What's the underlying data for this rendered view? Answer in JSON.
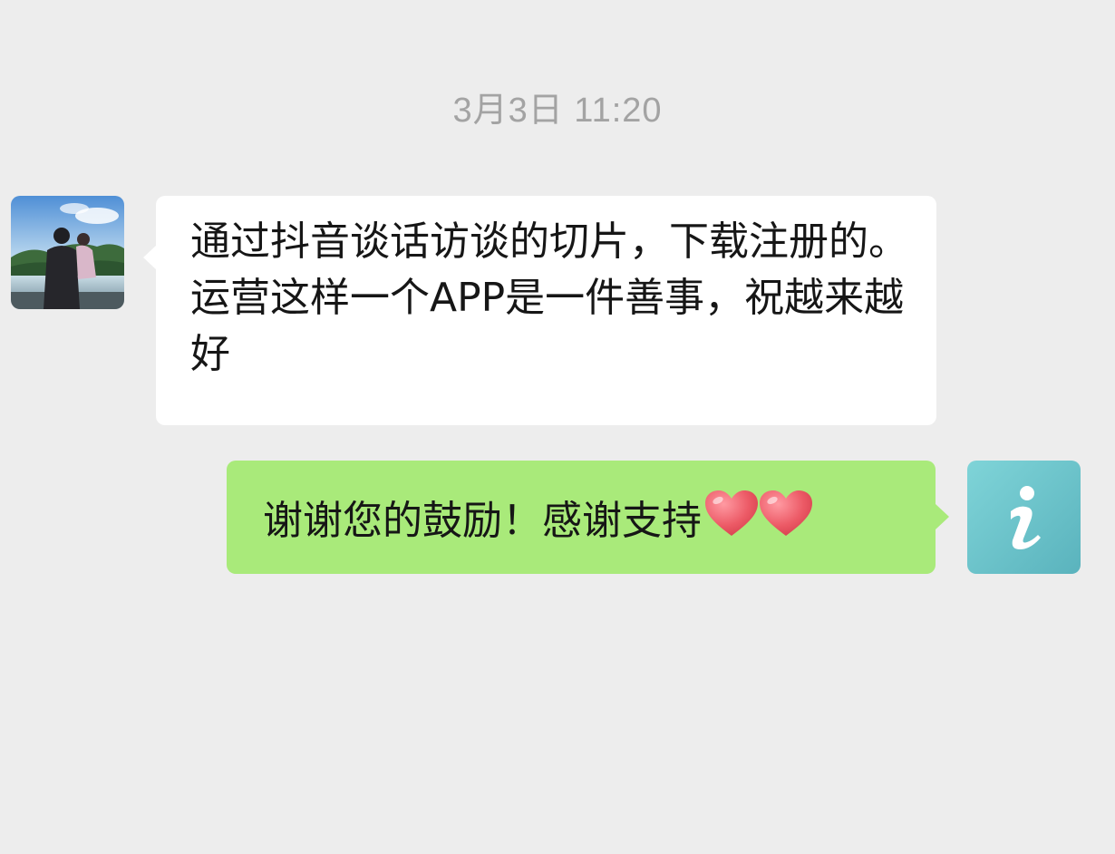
{
  "chat": {
    "timestamp": "3月3日 11:20",
    "messages": [
      {
        "side": "incoming",
        "avatar": "user-photo-avatar",
        "text": "通过抖音谈话访谈的切片，下载注册的。运营这样一个APP是一件善事，祝越来越好"
      },
      {
        "side": "outgoing",
        "avatar": "info-icon-avatar",
        "text": "谢谢您的鼓励！感谢支持",
        "emoji": [
          "heart-emoji",
          "heart-emoji"
        ]
      }
    ]
  },
  "colors": {
    "background": "#ededed",
    "incoming_bubble": "#ffffff",
    "outgoing_bubble": "#a9ea7a",
    "timestamp_text": "#a3a3a3",
    "info_avatar": "#6cc4cb",
    "heart": "#e8505b"
  }
}
